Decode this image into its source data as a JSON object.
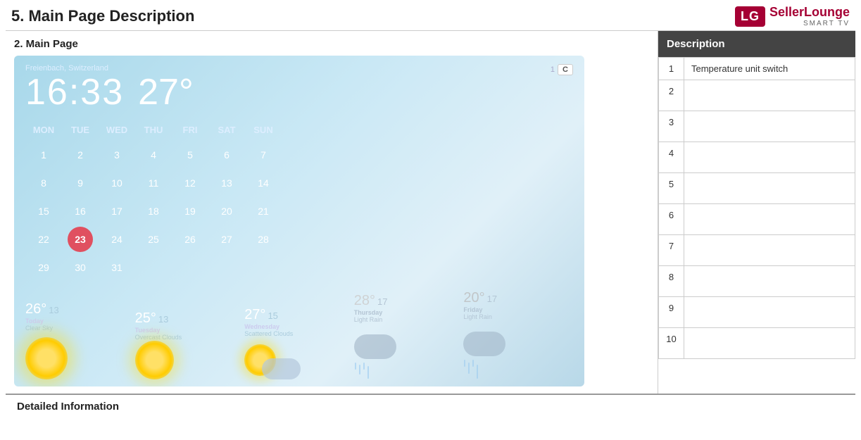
{
  "header": {
    "page_title": "5. Main Page Description",
    "logo_lg": "LG",
    "logo_seller": "Seller",
    "logo_lounge": "Lounge",
    "logo_smarttv": "SMART TV"
  },
  "section": {
    "title": "2. Main Page"
  },
  "weather": {
    "location": "Freienbach, Switzerland",
    "time": "16:33",
    "temperature": "27°",
    "unit_number": "1",
    "unit_btn": "C",
    "calendar": {
      "headers": [
        "MON",
        "TUE",
        "WED",
        "THU",
        "FRI",
        "SAT",
        "SUN"
      ],
      "weeks": [
        [
          "1",
          "2",
          "3",
          "4",
          "5",
          "6",
          "7"
        ],
        [
          "8",
          "9",
          "10",
          "11",
          "12",
          "13",
          "14"
        ],
        [
          "15",
          "16",
          "17",
          "18",
          "19",
          "20",
          "21"
        ],
        [
          "22",
          "23",
          "24",
          "25",
          "26",
          "27",
          "28"
        ],
        [
          "29",
          "30",
          "31",
          "",
          "",
          "",
          ""
        ]
      ],
      "today": "23"
    },
    "forecast": [
      {
        "day": "Today",
        "high": "26°",
        "low": "13",
        "desc": "Clear Sky",
        "icon": "sun"
      },
      {
        "day": "Tuesday",
        "high": "25°",
        "low": "13",
        "desc": "Overcast Clouds",
        "icon": "sun"
      },
      {
        "day": "Wednesday",
        "high": "27°",
        "low": "15",
        "desc": "Scattered Clouds",
        "icon": "cloud-sun"
      },
      {
        "day": "Thursday",
        "high": "28°",
        "low": "17",
        "desc": "Light Rain",
        "icon": "cloud-rain"
      },
      {
        "day": "Friday",
        "high": "20°",
        "low": "17",
        "desc": "Light Rain",
        "icon": "cloud-rain"
      }
    ]
  },
  "description_table": {
    "header": "Description",
    "rows": [
      {
        "num": "1",
        "text": "Temperature unit switch"
      },
      {
        "num": "2",
        "text": ""
      },
      {
        "num": "3",
        "text": ""
      },
      {
        "num": "4",
        "text": ""
      },
      {
        "num": "5",
        "text": ""
      },
      {
        "num": "6",
        "text": ""
      },
      {
        "num": "7",
        "text": ""
      },
      {
        "num": "8",
        "text": ""
      },
      {
        "num": "9",
        "text": ""
      },
      {
        "num": "10",
        "text": ""
      }
    ]
  },
  "bottom": {
    "title": "Detailed Information"
  }
}
